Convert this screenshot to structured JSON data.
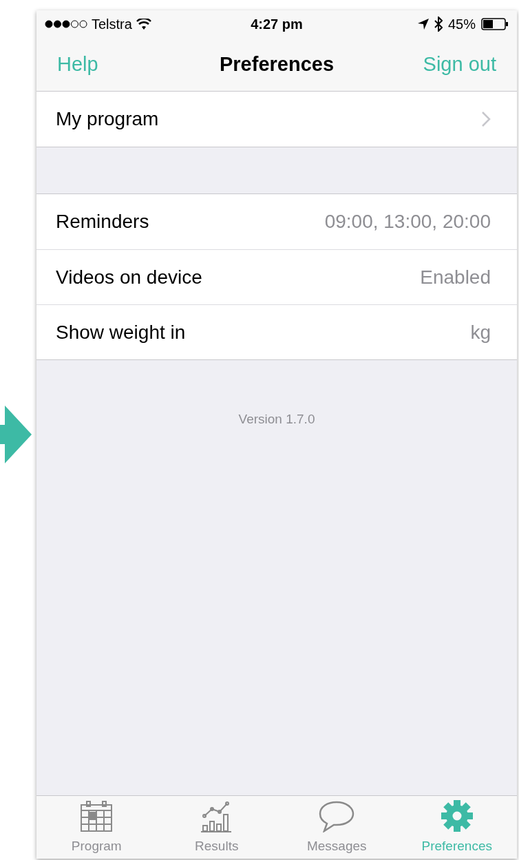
{
  "status_bar": {
    "carrier": "Telstra",
    "time": "4:27 pm",
    "battery": "45%"
  },
  "nav": {
    "left": "Help",
    "title": "Preferences",
    "right": "Sign out"
  },
  "sections": [
    {
      "rows": [
        {
          "label": "My program",
          "kind": "link"
        }
      ]
    },
    {
      "rows": [
        {
          "label": "Reminders",
          "value": "09:00, 13:00, 20:00",
          "kind": "value"
        },
        {
          "label": "Videos on device",
          "value": "Enabled",
          "kind": "value"
        },
        {
          "label": "Show weight in",
          "value": "kg",
          "kind": "value"
        }
      ]
    }
  ],
  "version": "Version 1.7.0",
  "tabs": [
    {
      "label": "Program",
      "kind": "calendar",
      "selected": false
    },
    {
      "label": "Results",
      "kind": "chart",
      "selected": false
    },
    {
      "label": "Messages",
      "kind": "bubble",
      "selected": false
    },
    {
      "label": "Preferences",
      "kind": "gear",
      "selected": true
    }
  ]
}
